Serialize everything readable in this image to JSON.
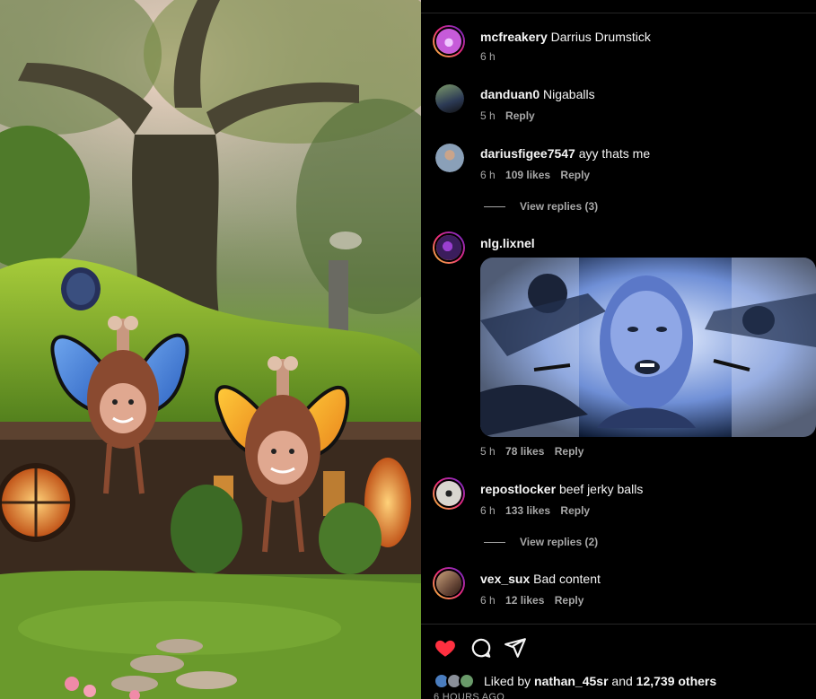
{
  "comments": [
    {
      "username": "mcfreakery",
      "text": "Darrius Drumstick",
      "time": "6 h",
      "likes": "",
      "reply": "",
      "avatar_color": "#c65bd9"
    },
    {
      "username": "danduan0",
      "text": "Nigaballs",
      "time": "5 h",
      "likes": "",
      "reply": "Reply",
      "avatar_color": "#3d4a3a"
    },
    {
      "username": "dariusfigee7547",
      "text": "ayy thats me",
      "time": "6 h",
      "likes": "109 likes",
      "reply": "Reply",
      "avatar_color": "#8aa0b8"
    },
    {
      "username": "nlg.lixnel",
      "text": "",
      "time": "5 h",
      "likes": "78 likes",
      "reply": "Reply",
      "avatar_color": "#3b1d5c"
    },
    {
      "username": "repostlocker",
      "text": "beef jerky balls",
      "time": "6 h",
      "likes": "133 likes",
      "reply": "Reply",
      "avatar_color": "#d9d6cf"
    },
    {
      "username": "vex_sux",
      "text": "Bad content",
      "time": "6 h",
      "likes": "12 likes",
      "reply": "Reply",
      "avatar_color": "#6b4a3a"
    }
  ],
  "view_replies": [
    "View replies (3)",
    "View replies (2)"
  ],
  "actions": {
    "like_icon": "heart-icon",
    "comment_icon": "comment-icon",
    "share_icon": "share-icon"
  },
  "liked_by": {
    "prefix": "Liked by",
    "user": "nathan_45sr",
    "middle": "and",
    "others": "12,739 others"
  },
  "time_ago": "6 HOURS AGO",
  "colors": {
    "heart": "#ff3040",
    "muted": "#a8a8a8",
    "ring_start": "#f9ce34",
    "ring_end": "#6228d7"
  }
}
